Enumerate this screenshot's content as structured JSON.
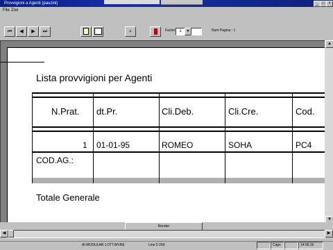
{
  "window": {
    "title": "Provvigioni a Agenti (pauzini)"
  },
  "menu": [
    "File",
    "Zoo"
  ],
  "toolbar": {
    "nav_buttons": [
      "first",
      "previous",
      "next",
      "last"
    ],
    "factor_label": "Factor:",
    "factor_value": "1",
    "pages_label": "Num Pagina : 1"
  },
  "report": {
    "title": "Lista provvigioni per Agenti",
    "columns": [
      "N.Prat.",
      "dt.Pr.",
      "Cli.Deb.",
      "Cli.Cre.",
      "Cod."
    ],
    "row": [
      "1",
      "01-01-95",
      "ROMEO",
      "SOHA",
      "PC4"
    ],
    "subrow_label": "COD.AG.:",
    "total_label": "Totale Generale"
  },
  "footer": {
    "button_label": "Render"
  },
  "status": {
    "left": "AI-MODULAR 1.0TT.WVRE",
    "middle": "Line 5 20d",
    "caps": "Caps",
    "time": "14:05:16"
  }
}
